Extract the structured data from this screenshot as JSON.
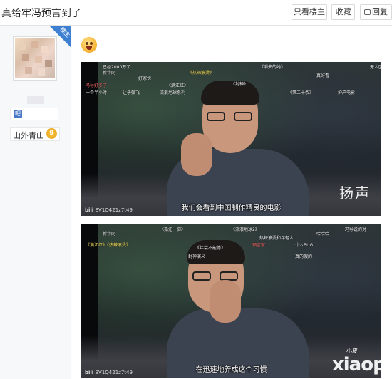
{
  "header": {
    "title": "真给牢冯预言到了",
    "only_op_label": "只看楼主",
    "favorite_label": "收藏",
    "reply_label": "回复"
  },
  "sidebar": {
    "ribbon_label": "楼主",
    "group_label": "山外青山",
    "group_level": "9"
  },
  "post": {
    "frames": [
      {
        "subtitle": "我们会看到中国制作精良的电影",
        "speaker": "扬声",
        "bili_id": "BV1Q421z7t49",
        "danmaku": [
          {
            "text": "已经2000万了",
            "c": ""
          },
          {
            "text": "新华网",
            "c": ""
          },
          {
            "text": "一个半小时",
            "c": ""
          },
          {
            "text": "让子弹飞",
            "c": ""
          },
          {
            "text": "流浪地球系列",
            "c": ""
          },
          {
            "text": "《满江红》",
            "c": ""
          },
          {
            "text": "《热辣滚烫》",
            "c": "y"
          },
          {
            "text": "《封神》",
            "c": ""
          },
          {
            "text": "《消失的她》",
            "c": ""
          },
          {
            "text": "《第二十条》",
            "c": ""
          },
          {
            "text": "无人区",
            "c": ""
          },
          {
            "text": "冯导好多了",
            "c": "r"
          },
          {
            "text": "沪产电影",
            "c": ""
          },
          {
            "text": "真好看",
            "c": ""
          },
          {
            "text": "好家伙",
            "c": ""
          }
        ]
      },
      {
        "subtitle": "在迅速地养成这个习惯",
        "speaker": "",
        "bili_id": "BV1Q421z7t49",
        "watermark": "xiaopi",
        "watermark_small": "小皮",
        "danmaku": [
          {
            "text": "新华网",
            "c": ""
          },
          {
            "text": "《满江红》《热辣滚烫》",
            "c": "y"
          },
          {
            "text": "《孤注一掷》",
            "c": ""
          },
          {
            "text": "《流浪地球2》",
            "c": ""
          },
          {
            "text": "热辣滚烫和年轻人",
            "c": ""
          },
          {
            "text": "《年会不能停》",
            "c": ""
          },
          {
            "text": "封神演义",
            "c": ""
          },
          {
            "text": "什么BUG",
            "c": ""
          },
          {
            "text": "预言家",
            "c": "r"
          },
          {
            "text": "真的假的",
            "c": ""
          },
          {
            "text": "冯导说的对",
            "c": ""
          },
          {
            "text": "哈哈哈",
            "c": ""
          }
        ]
      }
    ]
  }
}
